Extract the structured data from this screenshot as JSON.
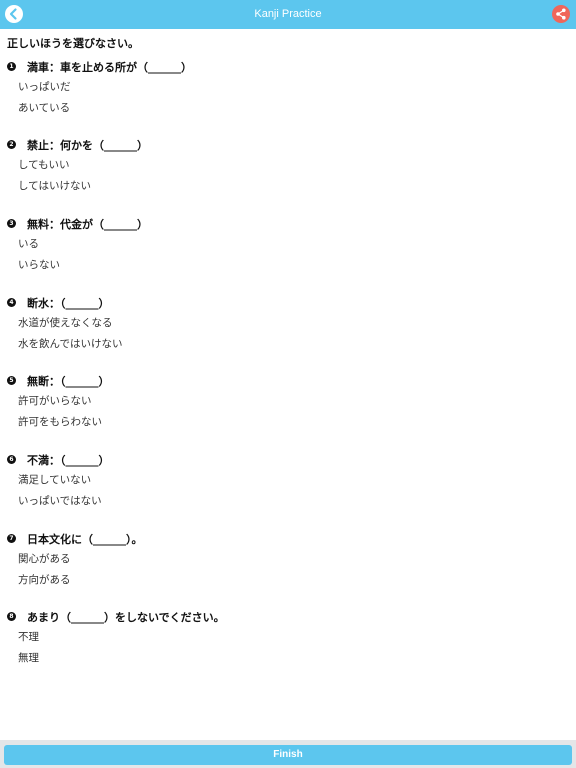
{
  "header": {
    "title": "Kanji Practice",
    "back_icon": "chevron-left-icon",
    "share_icon": "share-icon",
    "color": "#5cc6ee",
    "share_color": "#f0665a"
  },
  "instruction": "正しいほうを選びなさい。",
  "questions": [
    {
      "number": "1",
      "text": "満車：車を止める所が（______）",
      "options": [
        "いっぱいだ",
        "あいている"
      ]
    },
    {
      "number": "2",
      "text": "禁止：何かを（______）",
      "options": [
        "してもいい",
        "してはいけない"
      ]
    },
    {
      "number": "3",
      "text": "無料：代金が（______）",
      "options": [
        "いる",
        "いらない"
      ]
    },
    {
      "number": "4",
      "text": "断水：（______）",
      "options": [
        "水道が使えなくなる",
        "水を飲んではいけない"
      ]
    },
    {
      "number": "5",
      "text": "無断：（______）",
      "options": [
        "許可がいらない",
        "許可をもらわない"
      ]
    },
    {
      "number": "6",
      "text": "不満：（______）",
      "options": [
        "満足していない",
        "いっぱいではない"
      ]
    },
    {
      "number": "7",
      "text": "日本文化に（______）。",
      "options": [
        "関心がある",
        "方向がある"
      ]
    },
    {
      "number": "8",
      "text": "あまり（______）をしないでください。",
      "options": [
        "不理",
        "無理"
      ]
    }
  ],
  "footer": {
    "finish_label": "Finish"
  }
}
